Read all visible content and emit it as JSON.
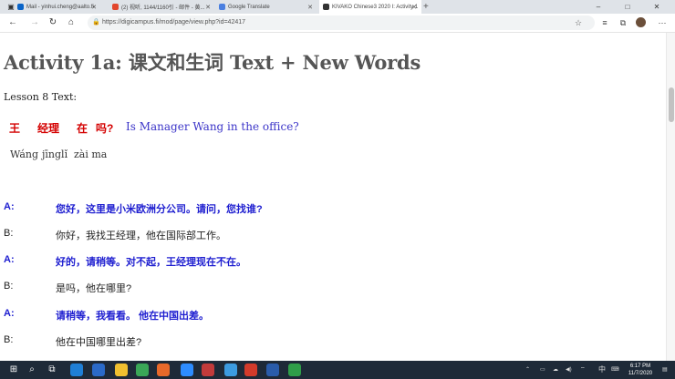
{
  "browser": {
    "tabs": [
      {
        "label": "Mail - yinhui.cheng@aalto.fi",
        "favicon_color": "#0a64c8",
        "active": false
      },
      {
        "label": "(2) 视听, 1144/1160引 - 邮件 - 黄...",
        "favicon_color": "#e2462c",
        "active": false
      },
      {
        "label": "Google Translate",
        "favicon_color": "#4a7fe0",
        "active": false
      },
      {
        "label": "KIVAKO Chinese3 2020 I: Activity 1",
        "favicon_color": "#333333",
        "active": true
      }
    ],
    "new_tab_symbol": "+",
    "url": "https://digicampus.fi/mod/page/view.php?id=42417",
    "window_controls": [
      "–",
      "□",
      "✕"
    ]
  },
  "page": {
    "title": "Activity 1a: 课文和生词 Text + New Words",
    "lesson_heading": "Lesson 8 Text:",
    "question": {
      "chars": [
        "王",
        "经理",
        "在",
        "吗?"
      ],
      "english": "Is Manager Wang in the office?",
      "pinyin": [
        "Wáng",
        "jīnglǐ",
        "zài ma"
      ]
    },
    "dialogue": [
      {
        "speaker": "A:",
        "text": "您好，这里是小米欧洲分公司。请问，您找谁?"
      },
      {
        "speaker": "B:",
        "text": "你好，我找王经理，他在国际部工作。"
      },
      {
        "speaker": "A:",
        "text": "好的，请稍等。对不起，王经理现在不在。"
      },
      {
        "speaker": "B:",
        "text": "是吗，他在哪里?"
      },
      {
        "speaker": "A:",
        "text": "请稍等，我看看。 他在中国出差。"
      },
      {
        "speaker": "B:",
        "text": "他在中国哪里出差?"
      }
    ]
  },
  "taskbar": {
    "tray_lang": "中",
    "time": "6:17 PM",
    "date": "11/7/2020"
  }
}
